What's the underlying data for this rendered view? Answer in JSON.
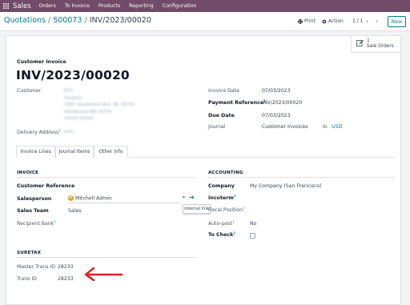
{
  "navbar": {
    "brand": "Sales",
    "items": [
      "Orders",
      "To Invoice",
      "Products",
      "Reporting",
      "Configuration"
    ]
  },
  "control_panel": {
    "breadcrumb": {
      "root": "Quotations",
      "parent": "S00073",
      "current": "INV/2023/00020",
      "separator": "/"
    },
    "print_label": "Print",
    "action_label": "Action",
    "pager": "1 / 1",
    "new_label": "New"
  },
  "smart_button": {
    "count": "1",
    "label": "Sale Orders"
  },
  "header": {
    "kind": "Customer Invoice",
    "number": "INV/2023/00020"
  },
  "left_fields": {
    "customer_label": "Customer",
    "customer_lines": [
      "John",
      "Portfolio",
      "1905 Sandiwood Ave, NC 30791",
      "Sandiwood WA 30791",
      "United States"
    ],
    "delivery_label": "Delivery Address",
    "delivery_value": "John"
  },
  "right_fields": {
    "invoice_date_label": "Invoice Date",
    "invoice_date_value": "07/03/2023",
    "payment_ref_label": "Payment Reference",
    "payment_ref_value": "INV/2023/00020",
    "due_date_label": "Due Date",
    "due_date_value": "07/03/2023",
    "journal_label": "Journal",
    "journal_value": "Customer Invoices",
    "journal_in": "in",
    "currency": "USD"
  },
  "tabs": [
    "Invoice Lines",
    "Journal Items",
    "Other Info"
  ],
  "other_info": {
    "invoice_section": "INVOICE",
    "customer_reference_label": "Customer Reference",
    "salesperson_label": "Salesperson",
    "salesperson_value": "Mitchell Admin",
    "salesperson_avatar": "M",
    "sales_team_label": "Sales Team",
    "sales_team_value": "Sales",
    "recipient_bank_label": "Recipient Bank",
    "internal_link_tooltip": "Internal link",
    "accounting_section": "ACCOUNTING",
    "company_label": "Company",
    "company_value": "My Company (San Francisco)",
    "incoterm_label": "Incoterm",
    "fiscal_position_label": "Fiscal Position",
    "auto_post_label": "Auto-post",
    "auto_post_value": "No",
    "to_check_label": "To Check",
    "suretax_section": "SURETAX",
    "master_trans_label": "Master Trans ID",
    "master_trans_value": "28233",
    "trans_label": "Trans ID",
    "trans_value": "28233"
  },
  "help_marker": "?",
  "colors": {
    "navbar": "#714b67",
    "accent": "#017e84",
    "annotation_arrow": "#e0242b",
    "avatar": "#d4a72c"
  }
}
